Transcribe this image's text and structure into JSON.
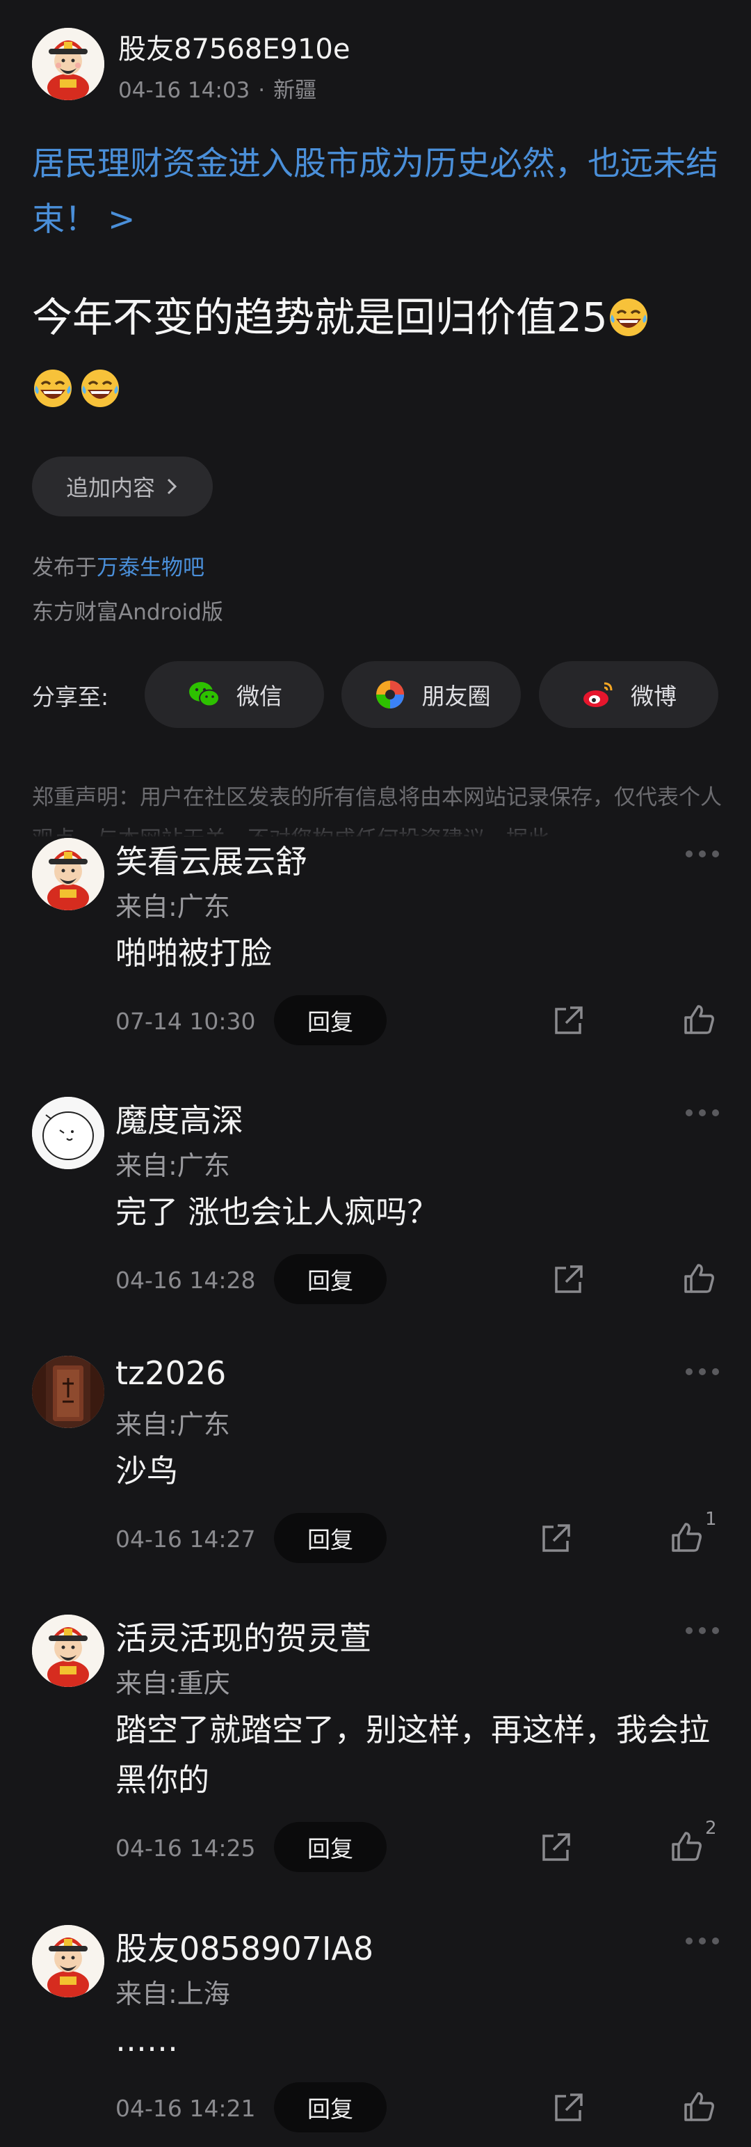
{
  "post": {
    "author": "股友87568E910e",
    "time": "04-16 14:03",
    "location": "新疆",
    "title": "居民理财资金进入股市成为历史必然，也远未结束！ >",
    "body_text": "今年不变的趋势就是回归价值25",
    "body_emoji": "grinning-sweat-emoji",
    "add_content_label": "追加内容",
    "published_prefix": "发布于",
    "published_forum": "万泰生物吧",
    "client": "东方财富Android版"
  },
  "share": {
    "label": "分享至:",
    "targets": [
      {
        "label": "微信",
        "icon": "wechat-icon",
        "color": "#2dc100"
      },
      {
        "label": "朋友圈",
        "icon": "moments-icon",
        "color": "#f5a623"
      },
      {
        "label": "微博",
        "icon": "weibo-icon",
        "color": "#e6162d"
      }
    ]
  },
  "disclaimer": "郑重声明：用户在社区发表的所有信息将由本网站记录保存，仅代表个人观点，与本网站无关，不对您构成任何投资建议，据此",
  "reply_label": "回复",
  "comments": [
    {
      "name": "笑看云展云舒",
      "location": "来自:广东",
      "text": "啪啪被打脸",
      "time": "07-14 10:30",
      "likes": ""
    },
    {
      "name": "魔度高深",
      "location": "来自:广东",
      "text": "完了 涨也会让人疯吗？",
      "time": "04-16 14:28",
      "likes": ""
    },
    {
      "name": "tz2026",
      "location": "来自:广东",
      "text": "沙鸟",
      "time": "04-16 14:27",
      "likes": "1"
    },
    {
      "name": "活灵活现的贺灵萱",
      "location": "来自:重庆",
      "text": "踏空了就踏空了，别这样，再这样，我会拉黑你的",
      "time": "04-16 14:25",
      "likes": "2"
    },
    {
      "name": "股友0858907IA8",
      "location": "来自:上海",
      "text": "……",
      "time": "04-16 14:21",
      "likes": ""
    }
  ],
  "colors": {
    "background": "#161618",
    "link": "#4a8fd9"
  }
}
